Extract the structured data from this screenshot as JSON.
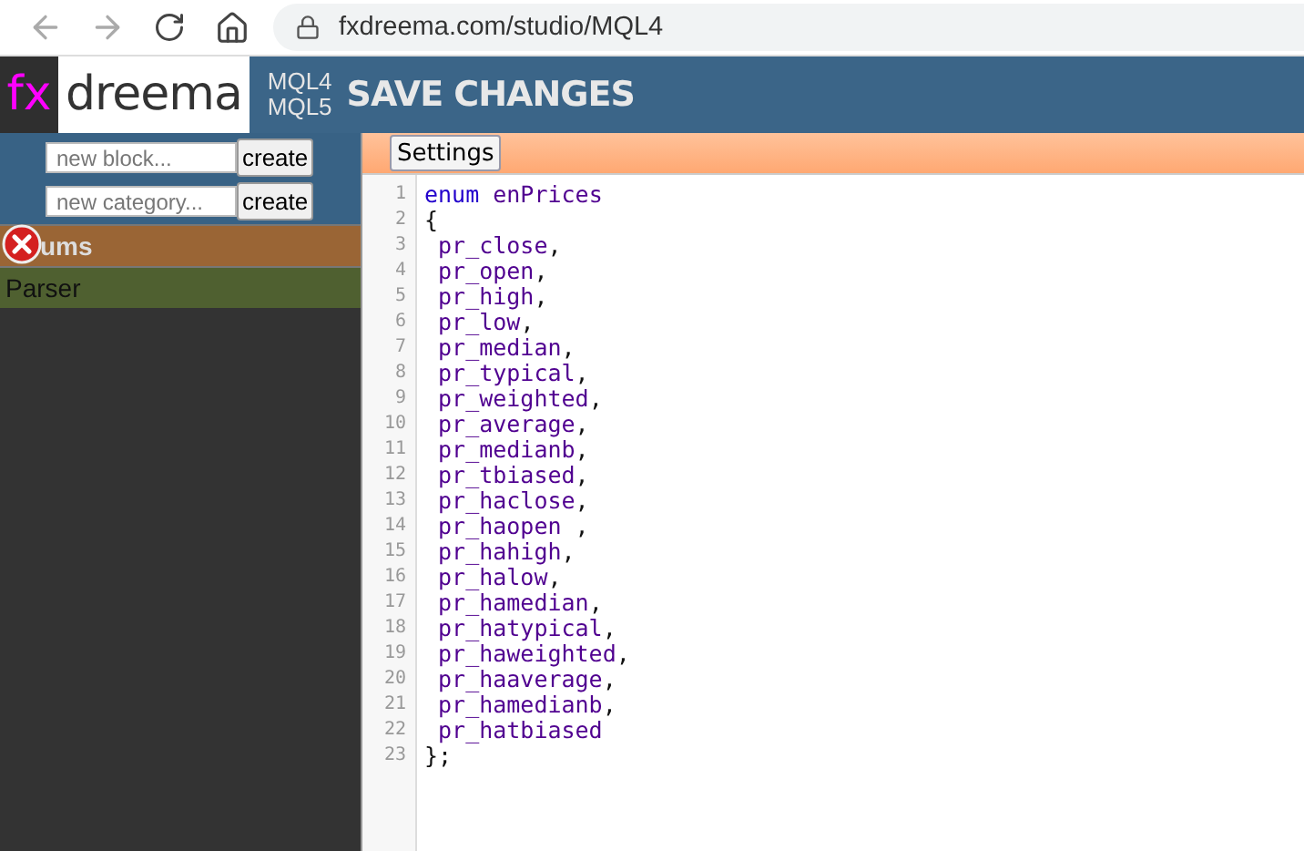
{
  "browser": {
    "url": "fxdreema.com/studio/MQL4",
    "back_disabled": true
  },
  "header": {
    "logo_fx": "fx",
    "logo_name": "dreema",
    "languages": [
      "MQL4",
      "MQL5"
    ],
    "save": "SAVE CHANGES"
  },
  "sidebar": {
    "forms": [
      {
        "placeholder": "new block...",
        "button": "create"
      },
      {
        "placeholder": "new category...",
        "button": "create"
      }
    ],
    "categories": [
      {
        "label": "ums",
        "color": "#9a6535",
        "closable": true
      },
      {
        "label": "Parser",
        "color": "#4f6030",
        "closable": false
      }
    ]
  },
  "editor": {
    "settings": "Settings",
    "lines": [
      {
        "number": "1",
        "tokens": [
          {
            "kind": "keyword",
            "text": "enum"
          },
          {
            "kind": "name",
            "text": " enPrices"
          }
        ]
      },
      {
        "number": "2",
        "tokens": [
          {
            "kind": "punct",
            "text": "{"
          }
        ]
      },
      {
        "number": "3",
        "tokens": [
          {
            "kind": "name",
            "text": " pr_close"
          },
          {
            "kind": "punct",
            "text": ","
          }
        ]
      },
      {
        "number": "4",
        "tokens": [
          {
            "kind": "name",
            "text": " pr_open"
          },
          {
            "kind": "punct",
            "text": ","
          }
        ]
      },
      {
        "number": "5",
        "tokens": [
          {
            "kind": "name",
            "text": " pr_high"
          },
          {
            "kind": "punct",
            "text": ","
          }
        ]
      },
      {
        "number": "6",
        "tokens": [
          {
            "kind": "name",
            "text": " pr_low"
          },
          {
            "kind": "punct",
            "text": ","
          }
        ]
      },
      {
        "number": "7",
        "tokens": [
          {
            "kind": "name",
            "text": " pr_median"
          },
          {
            "kind": "punct",
            "text": ","
          }
        ]
      },
      {
        "number": "8",
        "tokens": [
          {
            "kind": "name",
            "text": " pr_typical"
          },
          {
            "kind": "punct",
            "text": ","
          }
        ]
      },
      {
        "number": "9",
        "tokens": [
          {
            "kind": "name",
            "text": " pr_weighted"
          },
          {
            "kind": "punct",
            "text": ","
          }
        ]
      },
      {
        "number": "10",
        "tokens": [
          {
            "kind": "name",
            "text": " pr_average"
          },
          {
            "kind": "punct",
            "text": ","
          }
        ]
      },
      {
        "number": "11",
        "tokens": [
          {
            "kind": "name",
            "text": " pr_medianb"
          },
          {
            "kind": "punct",
            "text": ","
          }
        ]
      },
      {
        "number": "12",
        "tokens": [
          {
            "kind": "name",
            "text": " pr_tbiased"
          },
          {
            "kind": "punct",
            "text": ","
          }
        ]
      },
      {
        "number": "13",
        "tokens": [
          {
            "kind": "name",
            "text": " pr_haclose"
          },
          {
            "kind": "punct",
            "text": ","
          }
        ]
      },
      {
        "number": "14",
        "tokens": [
          {
            "kind": "name",
            "text": " pr_haopen"
          },
          {
            "kind": "punct",
            "text": " ,"
          }
        ]
      },
      {
        "number": "15",
        "tokens": [
          {
            "kind": "name",
            "text": " pr_hahigh"
          },
          {
            "kind": "punct",
            "text": ","
          }
        ]
      },
      {
        "number": "16",
        "tokens": [
          {
            "kind": "name",
            "text": " pr_halow"
          },
          {
            "kind": "punct",
            "text": ","
          }
        ]
      },
      {
        "number": "17",
        "tokens": [
          {
            "kind": "name",
            "text": " pr_hamedian"
          },
          {
            "kind": "punct",
            "text": ","
          }
        ]
      },
      {
        "number": "18",
        "tokens": [
          {
            "kind": "name",
            "text": " pr_hatypical"
          },
          {
            "kind": "punct",
            "text": ","
          }
        ]
      },
      {
        "number": "19",
        "tokens": [
          {
            "kind": "name",
            "text": " pr_haweighted"
          },
          {
            "kind": "punct",
            "text": ","
          }
        ]
      },
      {
        "number": "20",
        "tokens": [
          {
            "kind": "name",
            "text": " pr_haaverage"
          },
          {
            "kind": "punct",
            "text": ","
          }
        ]
      },
      {
        "number": "21",
        "tokens": [
          {
            "kind": "name",
            "text": " pr_hamedianb"
          },
          {
            "kind": "punct",
            "text": ","
          }
        ]
      },
      {
        "number": "22",
        "tokens": [
          {
            "kind": "name",
            "text": " pr_hatbiased"
          }
        ]
      },
      {
        "number": "23",
        "tokens": [
          {
            "kind": "punct",
            "text": "};"
          }
        ]
      }
    ]
  }
}
